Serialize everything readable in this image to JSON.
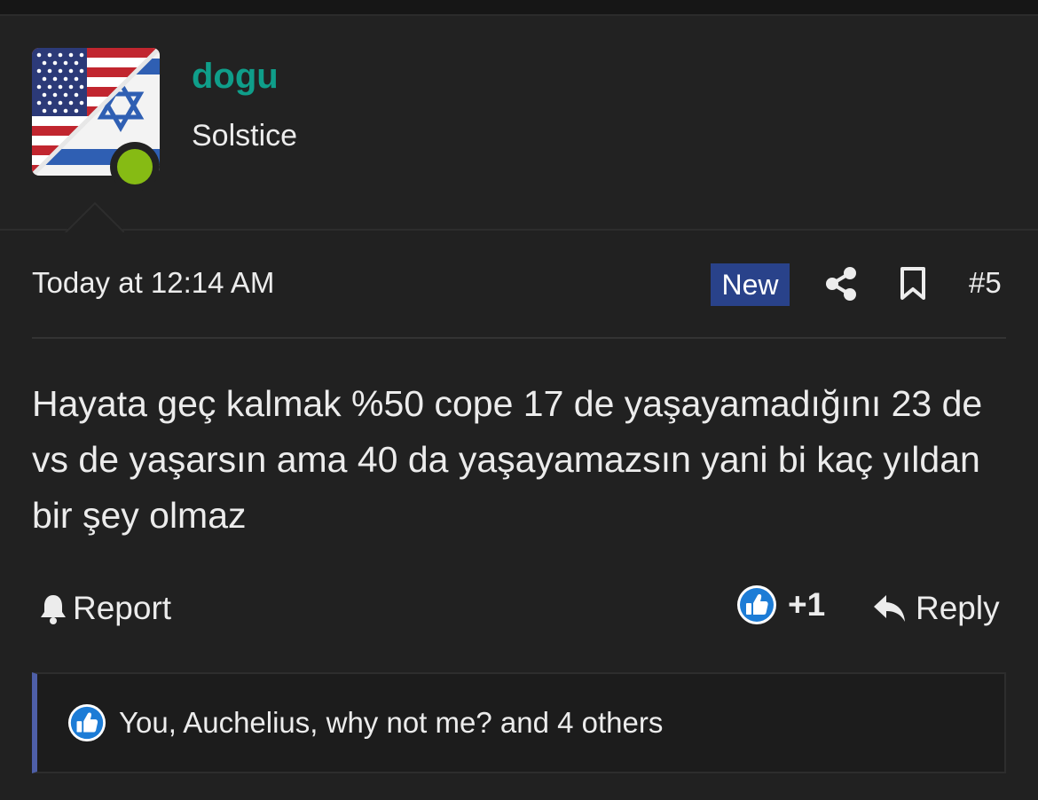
{
  "user": {
    "name": "dogu",
    "title": "Solstice"
  },
  "post": {
    "timestamp": "Today at 12:14 AM",
    "badge": "New",
    "number": "#5",
    "body": "Hayata geç kalmak %50 cope 17 de yaşayamadığını 23 de vs de yaşarsın ama 40 da yaşayamazsın yani bi kaç yıldan bir şey olmaz"
  },
  "actions": {
    "report_label": "Report",
    "like_count": "+1",
    "reply_label": "Reply"
  },
  "reactions": {
    "summary": "You, Auchelius, why not me? and 4 others"
  },
  "colors": {
    "username": "#0f9e8a",
    "online": "#86bb14",
    "badge": "#29428a",
    "like": "#1c7cd6",
    "reaction_accent": "#4e5fa8"
  },
  "icons": [
    "avatar-flag",
    "share-icon",
    "bookmark-icon",
    "bell-icon",
    "like-icon",
    "reply-icon"
  ]
}
